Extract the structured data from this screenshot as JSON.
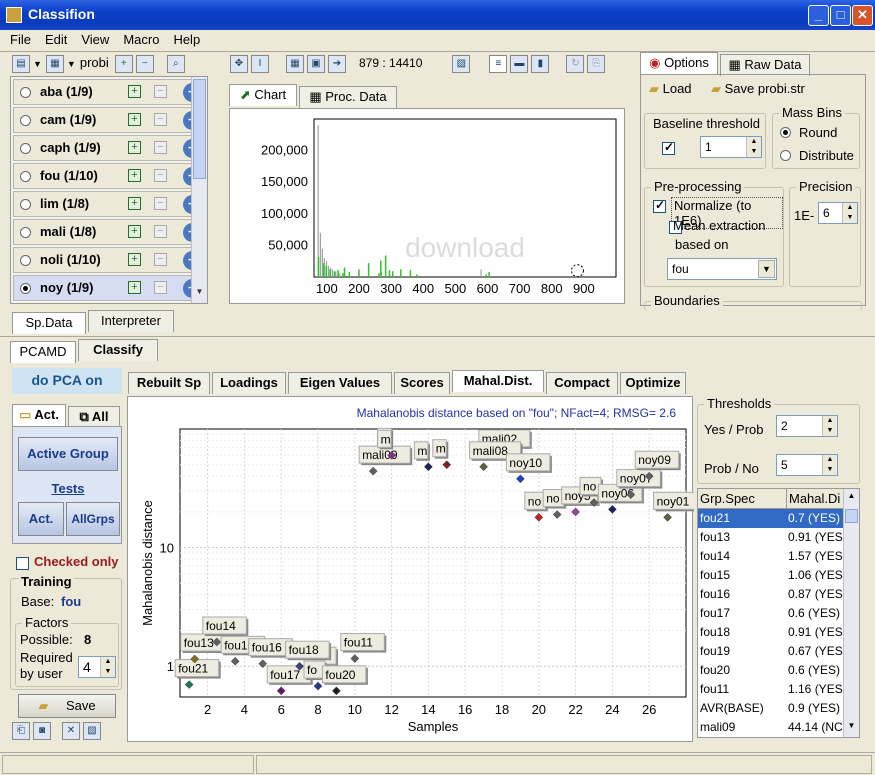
{
  "window": {
    "title": "Classifion"
  },
  "menu": [
    "File",
    "Edit",
    "View",
    "Macro",
    "Help"
  ],
  "left_toolbar": {
    "probe_label": "probi"
  },
  "species": [
    {
      "label": "aba (1/9)",
      "selected": false
    },
    {
      "label": "cam (1/9)",
      "selected": false
    },
    {
      "label": "caph (1/9)",
      "selected": false
    },
    {
      "label": "fou (1/10)",
      "selected": false
    },
    {
      "label": "lim (1/8)",
      "selected": false
    },
    {
      "label": "mali (1/8)",
      "selected": false
    },
    {
      "label": "noli (1/10)",
      "selected": false
    },
    {
      "label": "noy (1/9)",
      "selected": true
    }
  ],
  "left_tabs": {
    "sp_data": "Sp.Data",
    "interpreter": "Interpreter"
  },
  "chart_toolbar": {
    "coords": "879 : 14410"
  },
  "chart_tabs": {
    "chart": "Chart",
    "proc_data": "Proc. Data"
  },
  "spectrum_chart": {
    "type": "bar",
    "x_ticks": [
      "100",
      "200",
      "300",
      "400",
      "500",
      "600",
      "700",
      "800",
      "900"
    ],
    "y_ticks": [
      "200,000",
      "150,000",
      "100,000",
      "50,000"
    ],
    "xlim": [
      60,
      1000
    ],
    "ylim": [
      0,
      250000
    ],
    "peaks_gray": [
      [
        73,
        240000
      ],
      [
        80,
        70000
      ],
      [
        86,
        45000
      ],
      [
        92,
        30000
      ],
      [
        99,
        25000
      ],
      [
        105,
        18000
      ],
      [
        112,
        15000
      ],
      [
        118,
        12000
      ],
      [
        128,
        9000
      ],
      [
        140,
        6000
      ],
      [
        155,
        5000
      ],
      [
        200,
        4000
      ],
      [
        270,
        8000
      ],
      [
        580,
        12000
      ],
      [
        605,
        4000
      ],
      [
        870,
        3000
      ]
    ],
    "peaks_green": [
      [
        74,
        32000
      ],
      [
        90,
        22000
      ],
      [
        98,
        18000
      ],
      [
        110,
        12000
      ],
      [
        124,
        9000
      ],
      [
        135,
        11000
      ],
      [
        150,
        6000
      ],
      [
        155,
        15000
      ],
      [
        170,
        8000
      ],
      [
        200,
        12000
      ],
      [
        230,
        22000
      ],
      [
        262,
        6000
      ],
      [
        268,
        26000
      ],
      [
        283,
        34000
      ],
      [
        295,
        11000
      ],
      [
        305,
        9000
      ],
      [
        330,
        12000
      ],
      [
        360,
        11000
      ],
      [
        380,
        4000
      ],
      [
        596,
        4000
      ],
      [
        605,
        8000
      ]
    ],
    "marker": [
      880,
      10000
    ],
    "watermark": "download"
  },
  "options_tabs": {
    "options": "Options",
    "raw_data": "Raw Data"
  },
  "options": {
    "load": "Load",
    "save": "Save",
    "file": "probi.str",
    "baseline_label": "Baseline threshold",
    "baseline_value": "1",
    "mass_bins_label": "Mass Bins",
    "round": "Round",
    "distribute": "Distribute",
    "preprocessing_label": "Pre-processing",
    "normalize": "Normalize (to 1E6)",
    "mean_extraction": "Mean extraction",
    "based_on": "based on",
    "based_on_value": "fou",
    "precision_label": "Precision",
    "precision_prefix": "1E-",
    "precision_value": "6",
    "boundaries_label": "Boundaries"
  },
  "lower_tabs": {
    "pcamd": "PCAMD",
    "classify": "Classify"
  },
  "pca_heading": "do PCA on",
  "side": {
    "act_tab": "Act.",
    "all_tab": "All",
    "active_group": "Active Group",
    "tests": "Tests",
    "act_btn": "Act.",
    "allgrps_btn": "AllGrps",
    "checked_only": "Checked only",
    "training_label": "Training",
    "base_label": "Base:",
    "base_value": "fou",
    "factors_label": "Factors",
    "possible_label": "Possible:",
    "possible_value": "8",
    "required_label": "Required",
    "by_user_label": "by user",
    "required_value": "4",
    "save": "Save"
  },
  "analysis_tabs": [
    "Rebuilt Sp",
    "Loadings",
    "Eigen Values",
    "Scores",
    "Mahal.Dist.",
    "Compact",
    "Optimize"
  ],
  "active_analysis_tab": "Mahal.Dist.",
  "chart_data": {
    "type": "scatter",
    "title": "Mahalanobis distance based on \"fou\"; NFact=4; RMSG= 2.6",
    "xlabel": "Samples",
    "ylabel": "Mahalanobis distance",
    "x_ticks": [
      2,
      4,
      6,
      8,
      10,
      12,
      14,
      16,
      18,
      20,
      22,
      24,
      26
    ],
    "y_ticks": [
      1,
      10
    ],
    "xlim": [
      0.5,
      28
    ],
    "ylim": [
      0.55,
      100
    ],
    "y_scale": "log",
    "grid": true,
    "points": [
      {
        "x": 1,
        "y": 0.7,
        "label": "fou21",
        "color": "#207860"
      },
      {
        "x": 1.3,
        "y": 1.15,
        "label": "fou13",
        "color": "#807020"
      },
      {
        "x": 2.5,
        "y": 1.6,
        "label": "fou14",
        "color": "#606060"
      },
      {
        "x": 3.5,
        "y": 1.1,
        "label": "fou15",
        "color": "#606060"
      },
      {
        "x": 5,
        "y": 1.05,
        "label": "fou16",
        "color": "#606060"
      },
      {
        "x": 6,
        "y": 0.62,
        "label": "fou17",
        "color": "#602060"
      },
      {
        "x": 7,
        "y": 1.0,
        "label": "fou18",
        "color": "#404080"
      },
      {
        "x": 8,
        "y": 0.68,
        "label": "fo",
        "color": "#2a3a8a"
      },
      {
        "x": 9,
        "y": 0.62,
        "label": "fou20",
        "color": "#202020"
      },
      {
        "x": 10,
        "y": 1.16,
        "label": "fou11",
        "color": "#606060"
      },
      {
        "x": 11,
        "y": 44.14,
        "label": "mali09",
        "color": "#606060"
      },
      {
        "x": 12,
        "y": 60,
        "label": "m",
        "color": "#8a2a8a"
      },
      {
        "x": 14,
        "y": 48,
        "label": "m",
        "color": "#202060"
      },
      {
        "x": 15,
        "y": 50,
        "label": "m",
        "color": "#802020"
      },
      {
        "x": 17,
        "y": 48,
        "label": "mali08",
        "color": "#606040"
      },
      {
        "x": 19,
        "y": 38,
        "label": "noy10",
        "color": "#2040c0"
      },
      {
        "x": 20,
        "y": 18,
        "label": "no",
        "color": "#c02020"
      },
      {
        "x": 21,
        "y": 19,
        "label": "no",
        "color": "#606060"
      },
      {
        "x": 22,
        "y": 20,
        "label": "noy5",
        "color": "#a040a0"
      },
      {
        "x": 23,
        "y": 24,
        "label": "no",
        "color": "#606060"
      },
      {
        "x": 24,
        "y": 21,
        "label": "noy06",
        "color": "#202060"
      },
      {
        "x": 25,
        "y": 28,
        "label": "noy07",
        "color": "#606060"
      },
      {
        "x": 26,
        "y": 40,
        "label": "noy09",
        "color": "#606060"
      },
      {
        "x": 27,
        "y": 18,
        "label": "noy01",
        "color": "#606040"
      }
    ],
    "extra_labels": [
      {
        "x": 12,
        "y": 70,
        "label": "m"
      },
      {
        "x": 17.5,
        "y": 68,
        "label": "mali02"
      },
      {
        "x": 8.6,
        "y": 1.0,
        "label": "fo"
      }
    ]
  },
  "thresholds": {
    "label": "Thresholds",
    "yes_prob_label": "Yes / Prob",
    "yes_prob_value": "2",
    "prob_no_label": "Prob / No",
    "prob_no_value": "5"
  },
  "table": {
    "headers": [
      "Grp.Spec",
      "Mahal.Di"
    ],
    "rows": [
      [
        "fou21",
        "0.7 (YES)"
      ],
      [
        "fou13",
        "0.91 (YES"
      ],
      [
        "fou14",
        "1.57 (YES"
      ],
      [
        "fou15",
        "1.06 (YES"
      ],
      [
        "fou16",
        "0.87 (YES"
      ],
      [
        "fou17",
        "0.6 (YES)"
      ],
      [
        "fou18",
        "0.91 (YES"
      ],
      [
        "fou19",
        "0.67 (YES"
      ],
      [
        "fou20",
        "0.6 (YES)"
      ],
      [
        "fou11",
        "1.16 (YES"
      ],
      [
        "AVR(BASE)",
        "0.9 (YES)"
      ],
      [
        "mali09",
        "44.14 (NC"
      ]
    ],
    "selected_row": 0
  }
}
